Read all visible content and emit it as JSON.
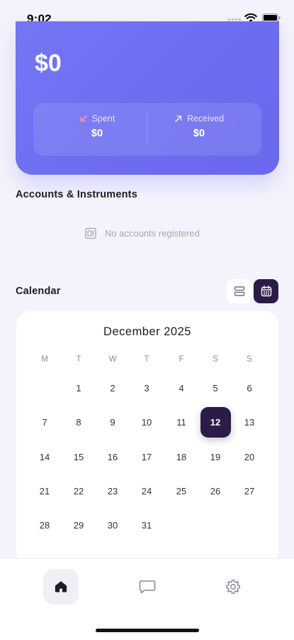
{
  "status_bar": {
    "time": "9:02"
  },
  "balance": {
    "total": "$0",
    "spent_label": "Spent",
    "spent_value": "$0",
    "received_label": "Received",
    "received_value": "$0"
  },
  "accounts": {
    "title": "Accounts & Instruments",
    "empty_text": "No accounts registered"
  },
  "calendar": {
    "title": "Calendar",
    "month": "December 2025",
    "weekdays": [
      "M",
      "T",
      "W",
      "T",
      "F",
      "S",
      "S"
    ],
    "days": [
      "1",
      "2",
      "3",
      "4",
      "5",
      "6",
      "7",
      "8",
      "9",
      "10",
      "11",
      "12",
      "13",
      "14",
      "15",
      "16",
      "17",
      "18",
      "19",
      "20",
      "21",
      "22",
      "23",
      "24",
      "25",
      "26",
      "27",
      "28",
      "29",
      "30",
      "31"
    ],
    "first_weekday_offset": 1,
    "selected_day": "12",
    "view_mode": "calendar"
  },
  "nav": {
    "active": "home",
    "items": [
      "home-icon",
      "chat-icon",
      "gear-icon"
    ]
  },
  "colors": {
    "accent": "#6d6cf1",
    "dark": "#2a1c46",
    "background": "#f4f3fc"
  }
}
